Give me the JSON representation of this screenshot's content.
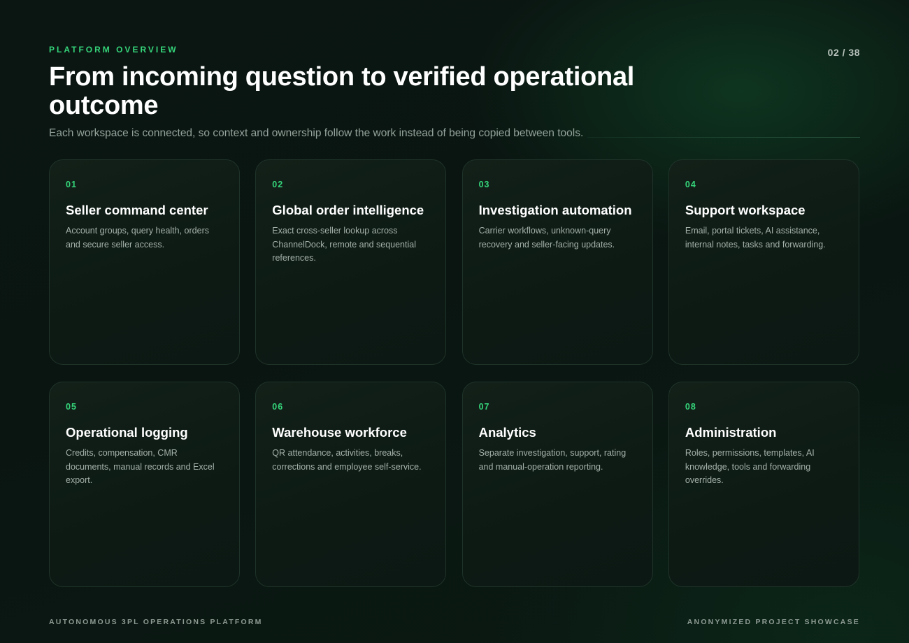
{
  "header": {
    "eyebrow": "PLATFORM OVERVIEW",
    "page_indicator": "02 / 38",
    "title": "From incoming question to verified operational outcome",
    "subtitle": "Each workspace is connected, so context and ownership follow the work instead of being copied between tools."
  },
  "cards": [
    {
      "number": "01",
      "title": "Seller command center",
      "description": "Account groups, query health, orders and secure seller access."
    },
    {
      "number": "02",
      "title": "Global order intelligence",
      "description": "Exact cross-seller lookup across ChannelDock, remote and sequential references."
    },
    {
      "number": "03",
      "title": "Investigation automation",
      "description": "Carrier workflows, unknown-query recovery and seller-facing updates."
    },
    {
      "number": "04",
      "title": "Support workspace",
      "description": "Email, portal tickets, AI assistance, internal notes, tasks and forwarding."
    },
    {
      "number": "05",
      "title": "Operational logging",
      "description": "Credits, compensation, CMR documents, manual records and Excel export."
    },
    {
      "number": "06",
      "title": "Warehouse workforce",
      "description": "QR attendance, activities, breaks, corrections and employee self-service."
    },
    {
      "number": "07",
      "title": "Analytics",
      "description": "Separate investigation, support, rating and manual-operation reporting."
    },
    {
      "number": "08",
      "title": "Administration",
      "description": "Roles, permissions, templates, AI knowledge, tools and forwarding overrides."
    }
  ],
  "footer": {
    "left": "AUTONOMOUS 3PL OPERATIONS PLATFORM",
    "right": "ANONYMIZED PROJECT SHOWCASE"
  },
  "colors": {
    "accent": "#35d47a",
    "background": "#0a1511",
    "card_background": "#122019",
    "card_border": "#1f3329"
  }
}
